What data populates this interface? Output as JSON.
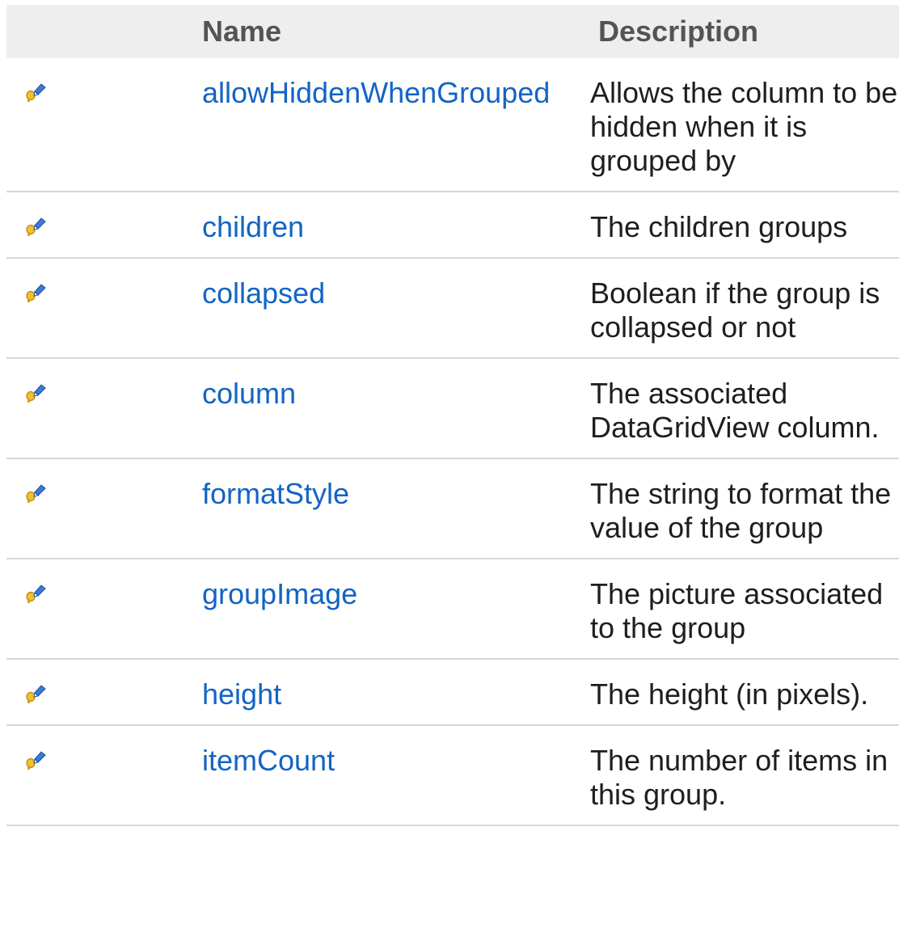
{
  "table": {
    "header": {
      "icon_col": "",
      "name_col": "Name",
      "description_col": "Description"
    },
    "icon_name": "public-property-icon",
    "rows": [
      {
        "name": "allowHiddenWhenGrouped",
        "description": "Allows the column to be hidden when it is grouped by"
      },
      {
        "name": "children",
        "description": "The children groups"
      },
      {
        "name": "collapsed",
        "description": "Boolean if the group is collapsed or not"
      },
      {
        "name": "column",
        "description": "The associated DataGridView column."
      },
      {
        "name": "formatStyle",
        "description": "The string to format the value of the group"
      },
      {
        "name": "groupImage",
        "description": "The picture associated to the group"
      },
      {
        "name": "height",
        "description": "The height (in pixels)."
      },
      {
        "name": "itemCount",
        "description": "The number of items in this group."
      }
    ]
  },
  "colors": {
    "header_bg": "#eeeeee",
    "header_text": "#545454",
    "link": "#1364c4",
    "row_border": "#d6d6d6"
  }
}
